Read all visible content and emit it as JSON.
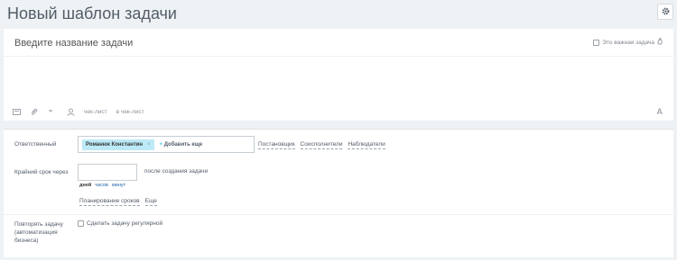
{
  "header": {
    "title": "Новый шаблон задачи"
  },
  "task": {
    "title_placeholder": "Введите название задачи",
    "important_label": "Это важная задача"
  },
  "toolbar": {
    "checklist_label": "чек-лист",
    "add_checklist_label": "в чек-лист"
  },
  "responsible": {
    "label": "Ответственный",
    "tag": "Романюк Константин",
    "tag_remove": "×",
    "add_more": "Добавить еще",
    "roles": [
      "Постановщик",
      "Соисполнители",
      "Наблюдатели"
    ]
  },
  "deadline": {
    "label": "Крайний срок через",
    "value": "",
    "after_text": "после создания задачи",
    "units": [
      "дней",
      "часов",
      "минут"
    ],
    "active_unit": "дней",
    "links": [
      "Планирование сроков",
      "Еще"
    ]
  },
  "repeat": {
    "label_lines": [
      "Повторять задачу",
      "(автоматизация",
      "бизнеса)"
    ],
    "checkbox_label": "Сделать задачу регулярной"
  },
  "colors": {
    "accent": "#2fc6f6",
    "tag_bg": "#bceaf6",
    "link": "#2067b0"
  }
}
